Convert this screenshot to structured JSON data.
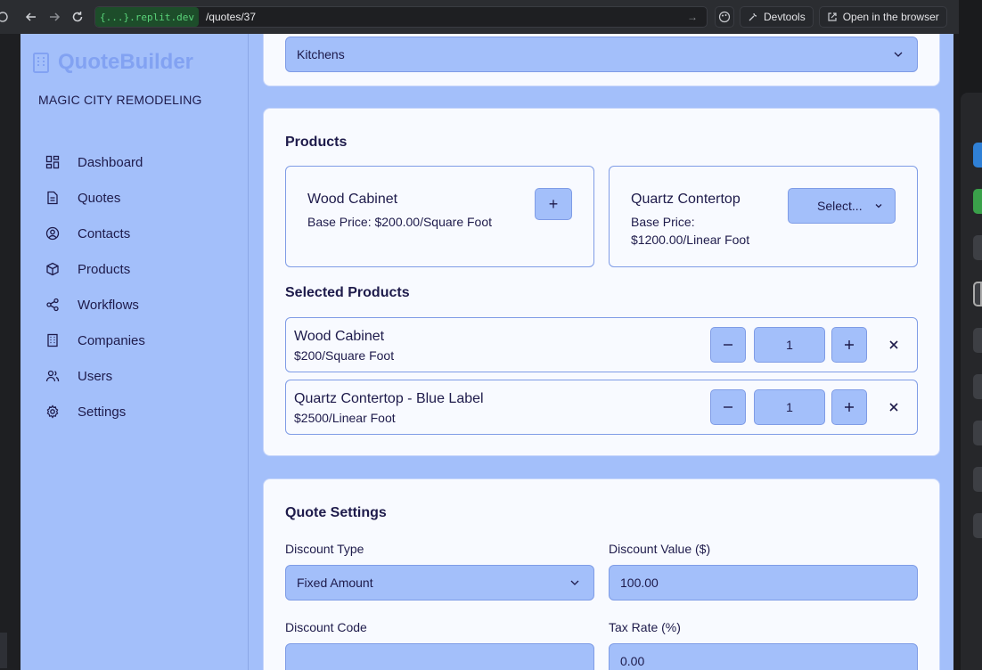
{
  "browser": {
    "url_host": "{...}.replit.dev",
    "url_path": "/quotes/37",
    "devtools_label": "Devtools",
    "open_browser_label": "Open in the browser"
  },
  "sidebar": {
    "brand": "QuoteBuilder",
    "company": "MAGIC CITY REMODELING",
    "items": [
      {
        "label": "Dashboard",
        "icon": "dashboard-icon"
      },
      {
        "label": "Quotes",
        "icon": "document-icon"
      },
      {
        "label": "Contacts",
        "icon": "user-circle-icon"
      },
      {
        "label": "Products",
        "icon": "box-icon"
      },
      {
        "label": "Workflows",
        "icon": "share-icon"
      },
      {
        "label": "Companies",
        "icon": "building-icon"
      },
      {
        "label": "Users",
        "icon": "users-icon"
      },
      {
        "label": "Settings",
        "icon": "gear-icon"
      }
    ]
  },
  "category_select": {
    "value": "Kitchens"
  },
  "products": {
    "title": "Products",
    "cards": [
      {
        "name": "Wood Cabinet",
        "price": "Base Price: $200.00/Square Foot",
        "action": "+"
      },
      {
        "name": "Quartz Contertop",
        "price_line1": "Base Price:",
        "price_line2": "$1200.00/Linear Foot",
        "action": "Select..."
      }
    ],
    "selected_title": "Selected Products",
    "selected": [
      {
        "name": "Wood Cabinet",
        "price": "$200/Square Foot",
        "qty": "1"
      },
      {
        "name": "Quartz Contertop - Blue Label",
        "price": "$2500/Linear Foot",
        "qty": "1"
      }
    ]
  },
  "quote_settings": {
    "title": "Quote Settings",
    "discount_type_label": "Discount Type",
    "discount_type_value": "Fixed Amount",
    "discount_value_label": "Discount Value ($)",
    "discount_value": "100.00",
    "discount_code_label": "Discount Code",
    "discount_code_value": "",
    "tax_rate_label": "Tax Rate (%)",
    "tax_rate_value": "0.00"
  },
  "colors": {
    "app_bg": "#a3bffa",
    "card_bg": "#f8faff",
    "text": "#1e1b4b",
    "brand": "#82a2f2"
  }
}
